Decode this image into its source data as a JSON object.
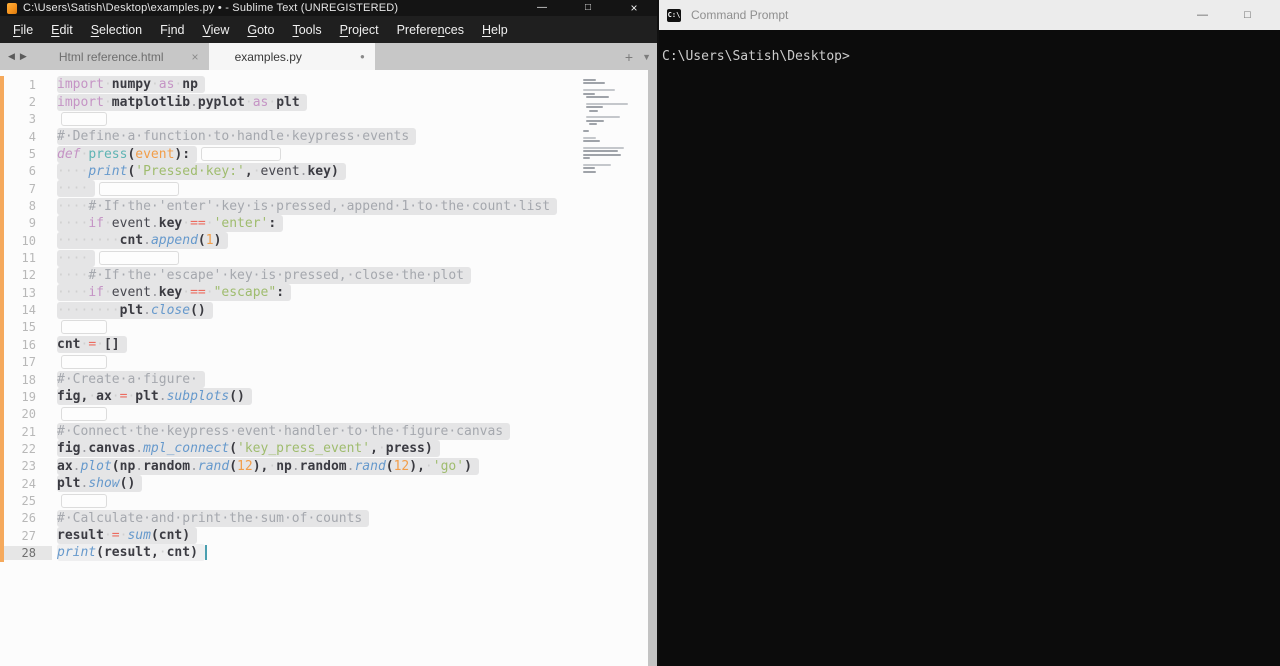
{
  "sublime": {
    "title": "C:\\Users\\Satish\\Desktop\\examples.py • - Sublime Text (UNREGISTERED)",
    "window_controls": {
      "minimize": "—",
      "maximize": "□",
      "close": "×"
    },
    "menu": {
      "items": [
        {
          "label": "File",
          "accel": 0
        },
        {
          "label": "Edit",
          "accel": 0
        },
        {
          "label": "Selection",
          "accel": 0
        },
        {
          "label": "Find",
          "accel": 1
        },
        {
          "label": "View",
          "accel": 0
        },
        {
          "label": "Goto",
          "accel": 0
        },
        {
          "label": "Tools",
          "accel": 0
        },
        {
          "label": "Project",
          "accel": 0
        },
        {
          "label": "Preferences",
          "accel": 7
        },
        {
          "label": "Help",
          "accel": 0
        }
      ]
    },
    "tabbar": {
      "nav_back_icon": "◀",
      "nav_forward_icon": "▶",
      "new_tab_icon": "+",
      "overflow_icon": "▼",
      "tabs": [
        {
          "label": "Html reference.html",
          "active": false,
          "close_icon": "×"
        },
        {
          "label": "examples.py",
          "active": true,
          "modified_icon": "●"
        }
      ]
    },
    "editor": {
      "active_line": 28,
      "colors": {
        "modified_gutter": "#f5a95c",
        "selection": "#e5e5e6",
        "cursor": "#4a9fb0"
      },
      "lines": [
        {
          "n": 1,
          "wb": 0,
          "segs": [
            [
              "kw",
              "import"
            ],
            [
              "w",
              "·"
            ],
            [
              "b",
              "numpy"
            ],
            [
              "w",
              "·"
            ],
            [
              "kw",
              "as"
            ],
            [
              "w",
              "·"
            ],
            [
              "b",
              "np"
            ]
          ]
        },
        {
          "n": 2,
          "wb": 0,
          "segs": [
            [
              "kw",
              "import"
            ],
            [
              "w",
              "·"
            ],
            [
              "b",
              "matplotlib"
            ],
            [
              "dt",
              "."
            ],
            [
              "b",
              "pyplot"
            ],
            [
              "w",
              "·"
            ],
            [
              "kw",
              "as"
            ],
            [
              "w",
              "·"
            ],
            [
              "b",
              "plt"
            ]
          ]
        },
        {
          "n": 3,
          "wb": 46,
          "segs": []
        },
        {
          "n": 4,
          "wb": 0,
          "segs": [
            [
              "c",
              "#·Define·a·function·to·handle·keypress·events"
            ]
          ]
        },
        {
          "n": 5,
          "wb": 80,
          "segs": [
            [
              "kwi",
              "def"
            ],
            [
              "w",
              "·"
            ],
            [
              "fn",
              "press"
            ],
            [
              "x",
              "("
            ],
            [
              "p",
              "event"
            ],
            [
              "x",
              "):"
            ]
          ]
        },
        {
          "n": 6,
          "wb": 0,
          "segs": [
            [
              "w",
              "····"
            ],
            [
              "fc",
              "print"
            ],
            [
              "x",
              "("
            ],
            [
              "s",
              "'Pressed·key:'"
            ],
            [
              "x",
              ","
            ],
            [
              "w",
              "·"
            ],
            [
              "i",
              "event"
            ],
            [
              "dt",
              "."
            ],
            [
              "b",
              "key"
            ],
            [
              "x",
              ")"
            ]
          ]
        },
        {
          "n": 7,
          "wb": 80,
          "segs": [
            [
              "w",
              "····"
            ]
          ]
        },
        {
          "n": 8,
          "wb": 0,
          "segs": [
            [
              "w",
              "····"
            ],
            [
              "c",
              "#·If·the·'enter'·key·is·pressed,·append·1·to·the·count·list"
            ]
          ]
        },
        {
          "n": 9,
          "wb": 0,
          "segs": [
            [
              "w",
              "····"
            ],
            [
              "kw",
              "if"
            ],
            [
              "w",
              "·"
            ],
            [
              "i",
              "event"
            ],
            [
              "dt",
              "."
            ],
            [
              "b",
              "key"
            ],
            [
              "w",
              "·"
            ],
            [
              "o",
              "=="
            ],
            [
              "w",
              "·"
            ],
            [
              "s",
              "'enter'"
            ],
            [
              "x",
              ":"
            ]
          ]
        },
        {
          "n": 10,
          "wb": 0,
          "segs": [
            [
              "w",
              "········"
            ],
            [
              "b",
              "cnt"
            ],
            [
              "dt",
              "."
            ],
            [
              "fc",
              "append"
            ],
            [
              "x",
              "("
            ],
            [
              "n",
              "1"
            ],
            [
              "x",
              ")"
            ]
          ]
        },
        {
          "n": 11,
          "wb": 80,
          "segs": [
            [
              "w",
              "····"
            ]
          ]
        },
        {
          "n": 12,
          "wb": 0,
          "segs": [
            [
              "w",
              "····"
            ],
            [
              "c",
              "#·If·the·'escape'·key·is·pressed,·close·the·plot"
            ]
          ]
        },
        {
          "n": 13,
          "wb": 0,
          "segs": [
            [
              "w",
              "····"
            ],
            [
              "kw",
              "if"
            ],
            [
              "w",
              "·"
            ],
            [
              "i",
              "event"
            ],
            [
              "dt",
              "."
            ],
            [
              "b",
              "key"
            ],
            [
              "w",
              "·"
            ],
            [
              "o",
              "=="
            ],
            [
              "w",
              "·"
            ],
            [
              "s",
              "\"escape\""
            ],
            [
              "x",
              ":"
            ]
          ]
        },
        {
          "n": 14,
          "wb": 0,
          "segs": [
            [
              "w",
              "········"
            ],
            [
              "b",
              "plt"
            ],
            [
              "dt",
              "."
            ],
            [
              "fc",
              "close"
            ],
            [
              "x",
              "()"
            ]
          ]
        },
        {
          "n": 15,
          "wb": 46,
          "segs": []
        },
        {
          "n": 16,
          "wb": 0,
          "segs": [
            [
              "b",
              "cnt"
            ],
            [
              "w",
              "·"
            ],
            [
              "o",
              "="
            ],
            [
              "w",
              "·"
            ],
            [
              "x",
              "[]"
            ]
          ]
        },
        {
          "n": 17,
          "wb": 46,
          "segs": []
        },
        {
          "n": 18,
          "wb": 0,
          "segs": [
            [
              "c",
              "#·Create·a·figure·"
            ]
          ]
        },
        {
          "n": 19,
          "wb": 0,
          "segs": [
            [
              "b",
              "fig"
            ],
            [
              "x",
              ","
            ],
            [
              "w",
              "·"
            ],
            [
              "b",
              "ax"
            ],
            [
              "w",
              "·"
            ],
            [
              "o",
              "="
            ],
            [
              "w",
              "·"
            ],
            [
              "b",
              "plt"
            ],
            [
              "dt",
              "."
            ],
            [
              "fc",
              "subplots"
            ],
            [
              "x",
              "()"
            ]
          ]
        },
        {
          "n": 20,
          "wb": 46,
          "segs": []
        },
        {
          "n": 21,
          "wb": 0,
          "segs": [
            [
              "c",
              "#·Connect·the·keypress·event·handler·to·the·figure·canvas"
            ]
          ]
        },
        {
          "n": 22,
          "wb": 0,
          "segs": [
            [
              "b",
              "fig"
            ],
            [
              "dt",
              "."
            ],
            [
              "b",
              "canvas"
            ],
            [
              "dt",
              "."
            ],
            [
              "fc",
              "mpl_connect"
            ],
            [
              "x",
              "("
            ],
            [
              "s",
              "'key_press_event'"
            ],
            [
              "x",
              ","
            ],
            [
              "w",
              "·"
            ],
            [
              "b",
              "press"
            ],
            [
              "x",
              ")"
            ]
          ]
        },
        {
          "n": 23,
          "wb": 0,
          "segs": [
            [
              "b",
              "ax"
            ],
            [
              "dt",
              "."
            ],
            [
              "fc",
              "plot"
            ],
            [
              "x",
              "("
            ],
            [
              "b",
              "np"
            ],
            [
              "dt",
              "."
            ],
            [
              "b",
              "random"
            ],
            [
              "dt",
              "."
            ],
            [
              "fc",
              "rand"
            ],
            [
              "x",
              "("
            ],
            [
              "n",
              "12"
            ],
            [
              "x",
              "),"
            ],
            [
              "w",
              "·"
            ],
            [
              "b",
              "np"
            ],
            [
              "dt",
              "."
            ],
            [
              "b",
              "random"
            ],
            [
              "dt",
              "."
            ],
            [
              "fc",
              "rand"
            ],
            [
              "x",
              "("
            ],
            [
              "n",
              "12"
            ],
            [
              "x",
              "),"
            ],
            [
              "w",
              "·"
            ],
            [
              "s",
              "'go'"
            ],
            [
              "x",
              ")"
            ]
          ]
        },
        {
          "n": 24,
          "wb": 0,
          "segs": [
            [
              "b",
              "plt"
            ],
            [
              "dt",
              "."
            ],
            [
              "fc",
              "show"
            ],
            [
              "x",
              "()"
            ]
          ]
        },
        {
          "n": 25,
          "wb": 46,
          "segs": []
        },
        {
          "n": 26,
          "wb": 0,
          "segs": [
            [
              "c",
              "#·Calculate·and·print·the·sum·of·counts"
            ]
          ]
        },
        {
          "n": 27,
          "wb": 0,
          "segs": [
            [
              "b",
              "result"
            ],
            [
              "w",
              "·"
            ],
            [
              "o",
              "="
            ],
            [
              "w",
              "·"
            ],
            [
              "fc",
              "sum"
            ],
            [
              "x",
              "("
            ],
            [
              "b",
              "cnt"
            ],
            [
              "x",
              ")"
            ]
          ]
        },
        {
          "n": 28,
          "wb": 0,
          "segs": [
            [
              "fc",
              "print"
            ],
            [
              "x",
              "("
            ],
            [
              "b",
              "result"
            ],
            [
              "x",
              ","
            ],
            [
              "w",
              "·"
            ],
            [
              "b",
              "cnt"
            ],
            [
              "x",
              ")"
            ]
          ]
        }
      ]
    }
  },
  "cmd": {
    "title": "Command Prompt",
    "window_controls": {
      "minimize": "—",
      "maximize": "□"
    },
    "prompt": "C:\\Users\\Satish\\Desktop>"
  }
}
